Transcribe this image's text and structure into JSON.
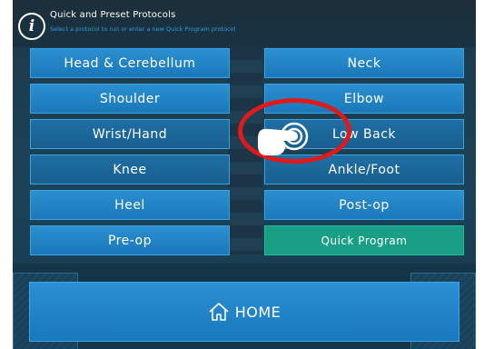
{
  "header": {
    "title": "Quick and Preset Protocols",
    "subtitle": "Select a protocol to run or enter a new Quick Program protocol",
    "info_icon": "info-icon"
  },
  "protocols_left": [
    "Head & Cerebellum",
    "Shoulder",
    "Wrist/Hand",
    "Knee",
    "Heel",
    "Pre-op"
  ],
  "protocols_right": [
    "Neck",
    "Elbow",
    "Low Back",
    "Ankle/Foot",
    "Post-op",
    "Quick Program"
  ],
  "footer": {
    "home_label": "HOME",
    "home_icon": "house-icon"
  },
  "overlay": {
    "pointer_icon": "hand-pointer-icon",
    "highlight_color": "#e01a1a"
  },
  "colors": {
    "button": "#1b78ba",
    "quick_program": "#1a9f87",
    "subtitle": "#2f9ee0"
  }
}
